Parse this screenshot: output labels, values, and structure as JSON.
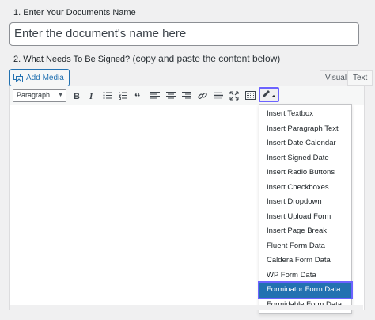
{
  "document_name": {
    "label": "1. Enter Your Documents Name",
    "placeholder": "Enter the document's name here"
  },
  "sign_section": {
    "label_bold": "2. What Needs To Be Signed?",
    "label_normal": " (copy and paste the content below)"
  },
  "toolbar": {
    "add_media": "Add Media",
    "tab_visual": "Visual",
    "tab_text": "Text",
    "format_select": "Paragraph",
    "buttons": [
      "bold",
      "italic",
      "bullet-list",
      "numbered-list",
      "blockquote",
      "align-left",
      "align-center",
      "align-right",
      "link",
      "horizontal-line",
      "fullscreen",
      "toolbar-toggle",
      "signature-fields"
    ]
  },
  "dropdown": {
    "items": [
      "Insert Textbox",
      "Insert Paragraph Text",
      "Insert Date Calendar",
      "Insert Signed Date",
      "Insert Radio Buttons",
      "Insert Checkboxes",
      "Insert Dropdown",
      "Insert Upload Form",
      "Insert Page Break",
      "Fluent Form Data",
      "Caldera Form Data",
      "WP Form Data",
      "Forminator Form Data",
      "Formidable Form Data"
    ],
    "highlighted": "Forminator Form Data"
  },
  "colors": {
    "accent": "#2271b1",
    "highlight_outline": "#6c63ff"
  }
}
